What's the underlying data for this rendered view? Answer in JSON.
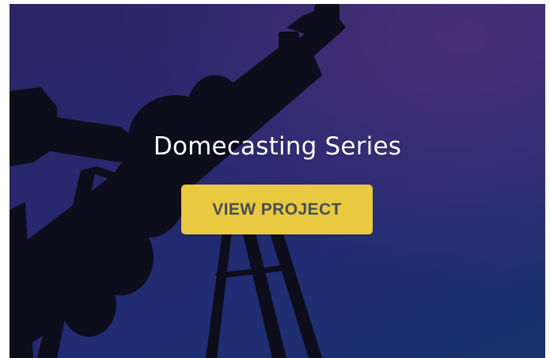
{
  "card": {
    "title": "Domecasting Series",
    "cta_label": "VIEW PROJECT",
    "background_image": "oil-rig-silhouette-image"
  },
  "colors": {
    "cta_background": "#e8c93f",
    "cta_text": "#4a4d57",
    "title_text": "#ffffff",
    "sky_top": "#2f2a6e",
    "sky_bottom": "#1a3a78"
  }
}
